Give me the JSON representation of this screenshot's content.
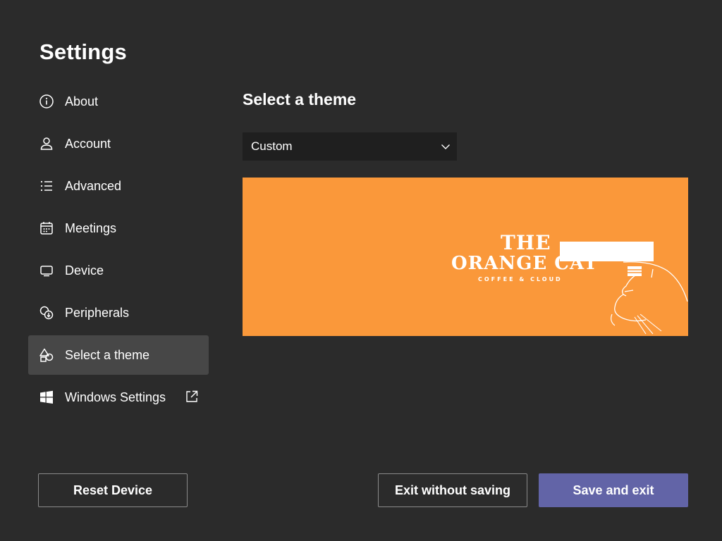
{
  "page": {
    "title": "Settings"
  },
  "sidebar": {
    "items": [
      {
        "label": "About",
        "icon": "info-icon"
      },
      {
        "label": "Account",
        "icon": "person-icon"
      },
      {
        "label": "Advanced",
        "icon": "list-icon"
      },
      {
        "label": "Meetings",
        "icon": "calendar-icon"
      },
      {
        "label": "Device",
        "icon": "monitor-icon"
      },
      {
        "label": "Peripherals",
        "icon": "peripherals-icon"
      },
      {
        "label": "Select a theme",
        "icon": "shapes-icon",
        "selected": true
      },
      {
        "label": "Windows Settings",
        "icon": "windows-icon",
        "external": true
      }
    ]
  },
  "main": {
    "section_title": "Select a theme",
    "theme_select": {
      "value": "Custom"
    },
    "preview": {
      "logo_line1": "THE",
      "logo_line2": "ORANGE CAT",
      "logo_line3": "COFFEE & CLOUD",
      "background_color": "#fa983a"
    }
  },
  "footer": {
    "reset_label": "Reset Device",
    "exit_label": "Exit without saving",
    "save_label": "Save and exit"
  },
  "colors": {
    "background": "#2b2b2b",
    "selected_nav": "#474747",
    "accent": "#6264a7",
    "dropdown_bg": "#1f1f1f"
  }
}
